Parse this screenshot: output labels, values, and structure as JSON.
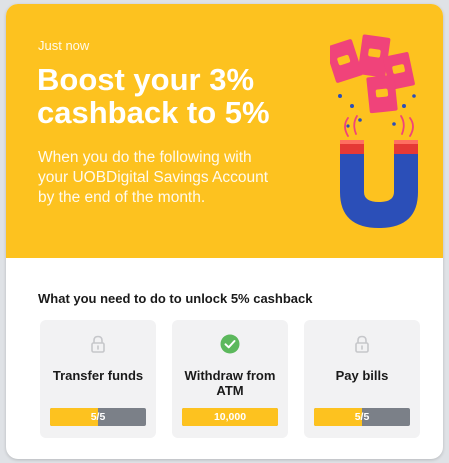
{
  "notification": {
    "timestamp": "Just now",
    "headline": "Boost your 3% cashback to 5%",
    "subtitle": "When you do the following with your UOBDigital Savings Account by the end of the month."
  },
  "requirements": {
    "title": "What you need to do to unlock 5% cashback",
    "tasks": [
      {
        "label": "Transfer funds",
        "icon": "lock-icon",
        "progress_text": "5/5",
        "progress_fraction": 0.5
      },
      {
        "label": "Withdraw from ATM",
        "icon": "check-circle-icon",
        "progress_text": "10,000",
        "progress_fraction": 1.0
      },
      {
        "label": "Pay bills",
        "icon": "lock-icon",
        "progress_text": "5/5",
        "progress_fraction": 0.5
      }
    ]
  },
  "colors": {
    "brand_yellow": "#fdc21f",
    "bar_track": "#7b8088",
    "check_green": "#5cb85c",
    "magnet_blue": "#2b4fb8",
    "magnet_red": "#e53935",
    "card_pink": "#f0437a"
  }
}
